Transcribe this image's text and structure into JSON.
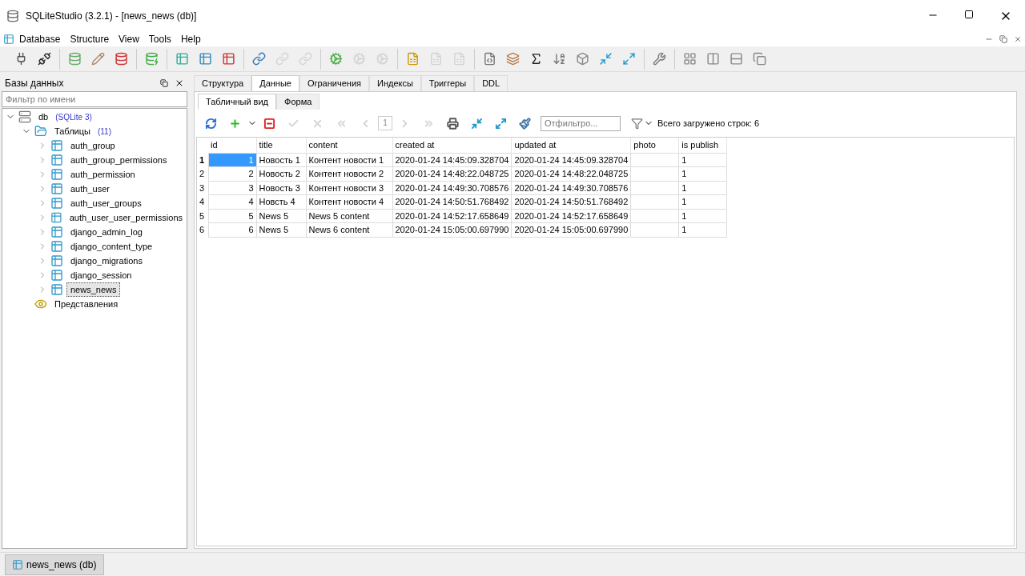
{
  "window": {
    "title": "SQLiteStudio (3.2.1) - [news_news (db)]"
  },
  "menu": [
    "Database",
    "Structure",
    "View",
    "Tools",
    "Help"
  ],
  "main_toolbar": [
    [
      {
        "disabled": false
      },
      {
        "disabled": false
      }
    ],
    [
      {
        "disabled": false
      },
      {
        "disabled": false
      },
      {
        "disabled": false
      }
    ],
    [
      {
        "disabled": false
      }
    ],
    [
      {
        "disabled": false
      },
      {
        "disabled": false
      },
      {
        "disabled": false
      }
    ],
    [
      {
        "disabled": false
      },
      {
        "disabled": true
      },
      {
        "disabled": true
      }
    ],
    [
      {
        "disabled": false
      },
      {
        "disabled": true
      },
      {
        "disabled": true
      }
    ],
    [
      {
        "disabled": false
      },
      {
        "disabled": true
      },
      {
        "disabled": true
      }
    ],
    [
      {
        "disabled": false
      },
      {
        "disabled": false
      },
      {
        "disabled": false
      },
      {
        "disabled": false
      },
      {
        "disabled": false
      },
      {
        "disabled": false
      },
      {
        "disabled": false
      }
    ],
    [
      {
        "disabled": false
      }
    ],
    [
      {
        "disabled": false
      },
      {
        "disabled": false
      },
      {
        "disabled": false
      },
      {
        "disabled": false
      }
    ]
  ],
  "db_panel": {
    "title": "Базы данных",
    "filter_placeholder": "Фильтр по имени",
    "tree": [
      {
        "label": "db",
        "badge": "(SQLite 3)",
        "kind": "database",
        "expanded": true,
        "selected": false,
        "children": [
          {
            "label": "Таблицы",
            "badge": "(11)",
            "kind": "folder",
            "expanded": true,
            "selected": false,
            "children": [
              {
                "label": "auth_group",
                "kind": "table",
                "expanded": false,
                "selected": false
              },
              {
                "label": "auth_group_permissions",
                "kind": "table",
                "expanded": false,
                "selected": false
              },
              {
                "label": "auth_permission",
                "kind": "table",
                "expanded": false,
                "selected": false
              },
              {
                "label": "auth_user",
                "kind": "table",
                "expanded": false,
                "selected": false
              },
              {
                "label": "auth_user_groups",
                "kind": "table",
                "expanded": false,
                "selected": false
              },
              {
                "label": "auth_user_user_permissions",
                "kind": "table",
                "expanded": false,
                "selected": false
              },
              {
                "label": "django_admin_log",
                "kind": "table",
                "expanded": false,
                "selected": false
              },
              {
                "label": "django_content_type",
                "kind": "table",
                "expanded": false,
                "selected": false
              },
              {
                "label": "django_migrations",
                "kind": "table",
                "expanded": false,
                "selected": false
              },
              {
                "label": "django_session",
                "kind": "table",
                "expanded": false,
                "selected": false
              },
              {
                "label": "news_news",
                "kind": "table",
                "expanded": false,
                "selected": true
              }
            ]
          },
          {
            "label": "Представления",
            "kind": "views",
            "selected": false
          }
        ]
      }
    ]
  },
  "tabs": [
    {
      "label": "Структура",
      "selected": false
    },
    {
      "label": "Данные",
      "selected": true
    },
    {
      "label": "Ограничения",
      "selected": false
    },
    {
      "label": "Индексы",
      "selected": false
    },
    {
      "label": "Триггеры",
      "selected": false
    },
    {
      "label": "DDL",
      "selected": false
    }
  ],
  "subtabs": [
    {
      "label": "Табличный вид",
      "selected": true
    },
    {
      "label": "Форма",
      "selected": false
    }
  ],
  "data_toolbar": {
    "buttons": [
      {
        "disabled": false
      },
      {
        "disabled": false
      },
      {
        "disabled": false
      },
      {
        "disabled": true
      },
      {
        "disabled": true
      },
      {
        "disabled": true
      },
      {
        "disabled": true
      },
      {
        "disabled": true
      },
      {
        "disabled": true
      },
      {
        "disabled": false
      },
      {
        "disabled": false
      },
      {
        "disabled": false
      },
      {
        "disabled": false
      }
    ],
    "page": "1",
    "filter_placeholder": "Отфильтро...",
    "total": "Всего загружено строк: 6"
  },
  "table": {
    "columns": [
      "id",
      "title",
      "content",
      "created at",
      "updated at",
      "photo",
      "is publish"
    ],
    "rows": [
      {
        "num": "1",
        "selected": true,
        "cells": [
          "1",
          "Новость 1",
          "Контент новости 1",
          "2020-01-24 14:45:09.328704",
          "2020-01-24 14:45:09.328704",
          "",
          "1"
        ]
      },
      {
        "num": "2",
        "selected": false,
        "cells": [
          "2",
          "Новость 2",
          "Контент новости 2",
          "2020-01-24 14:48:22.048725",
          "2020-01-24 14:48:22.048725",
          "",
          "1"
        ]
      },
      {
        "num": "3",
        "selected": false,
        "cells": [
          "3",
          "Новость 3",
          "Контент новости 3",
          "2020-01-24 14:49:30.708576",
          "2020-01-24 14:49:30.708576",
          "",
          "1"
        ]
      },
      {
        "num": "4",
        "selected": false,
        "cells": [
          "4",
          "Новсть 4",
          "Контент новости 4",
          "2020-01-24 14:50:51.768492",
          "2020-01-24 14:50:51.768492",
          "",
          "1"
        ]
      },
      {
        "num": "5",
        "selected": false,
        "cells": [
          "5",
          "News 5",
          "News 5 content",
          "2020-01-24 14:52:17.658649",
          "2020-01-24 14:52:17.658649",
          "",
          "1"
        ]
      },
      {
        "num": "6",
        "selected": false,
        "cells": [
          "6",
          "News 5",
          "News 6 content",
          "2020-01-24 15:05:00.697990",
          "2020-01-24 15:05:00.697990",
          "",
          "1"
        ]
      }
    ]
  },
  "taskbar": [
    {
      "label": "news_news (db)",
      "selected": true
    }
  ]
}
